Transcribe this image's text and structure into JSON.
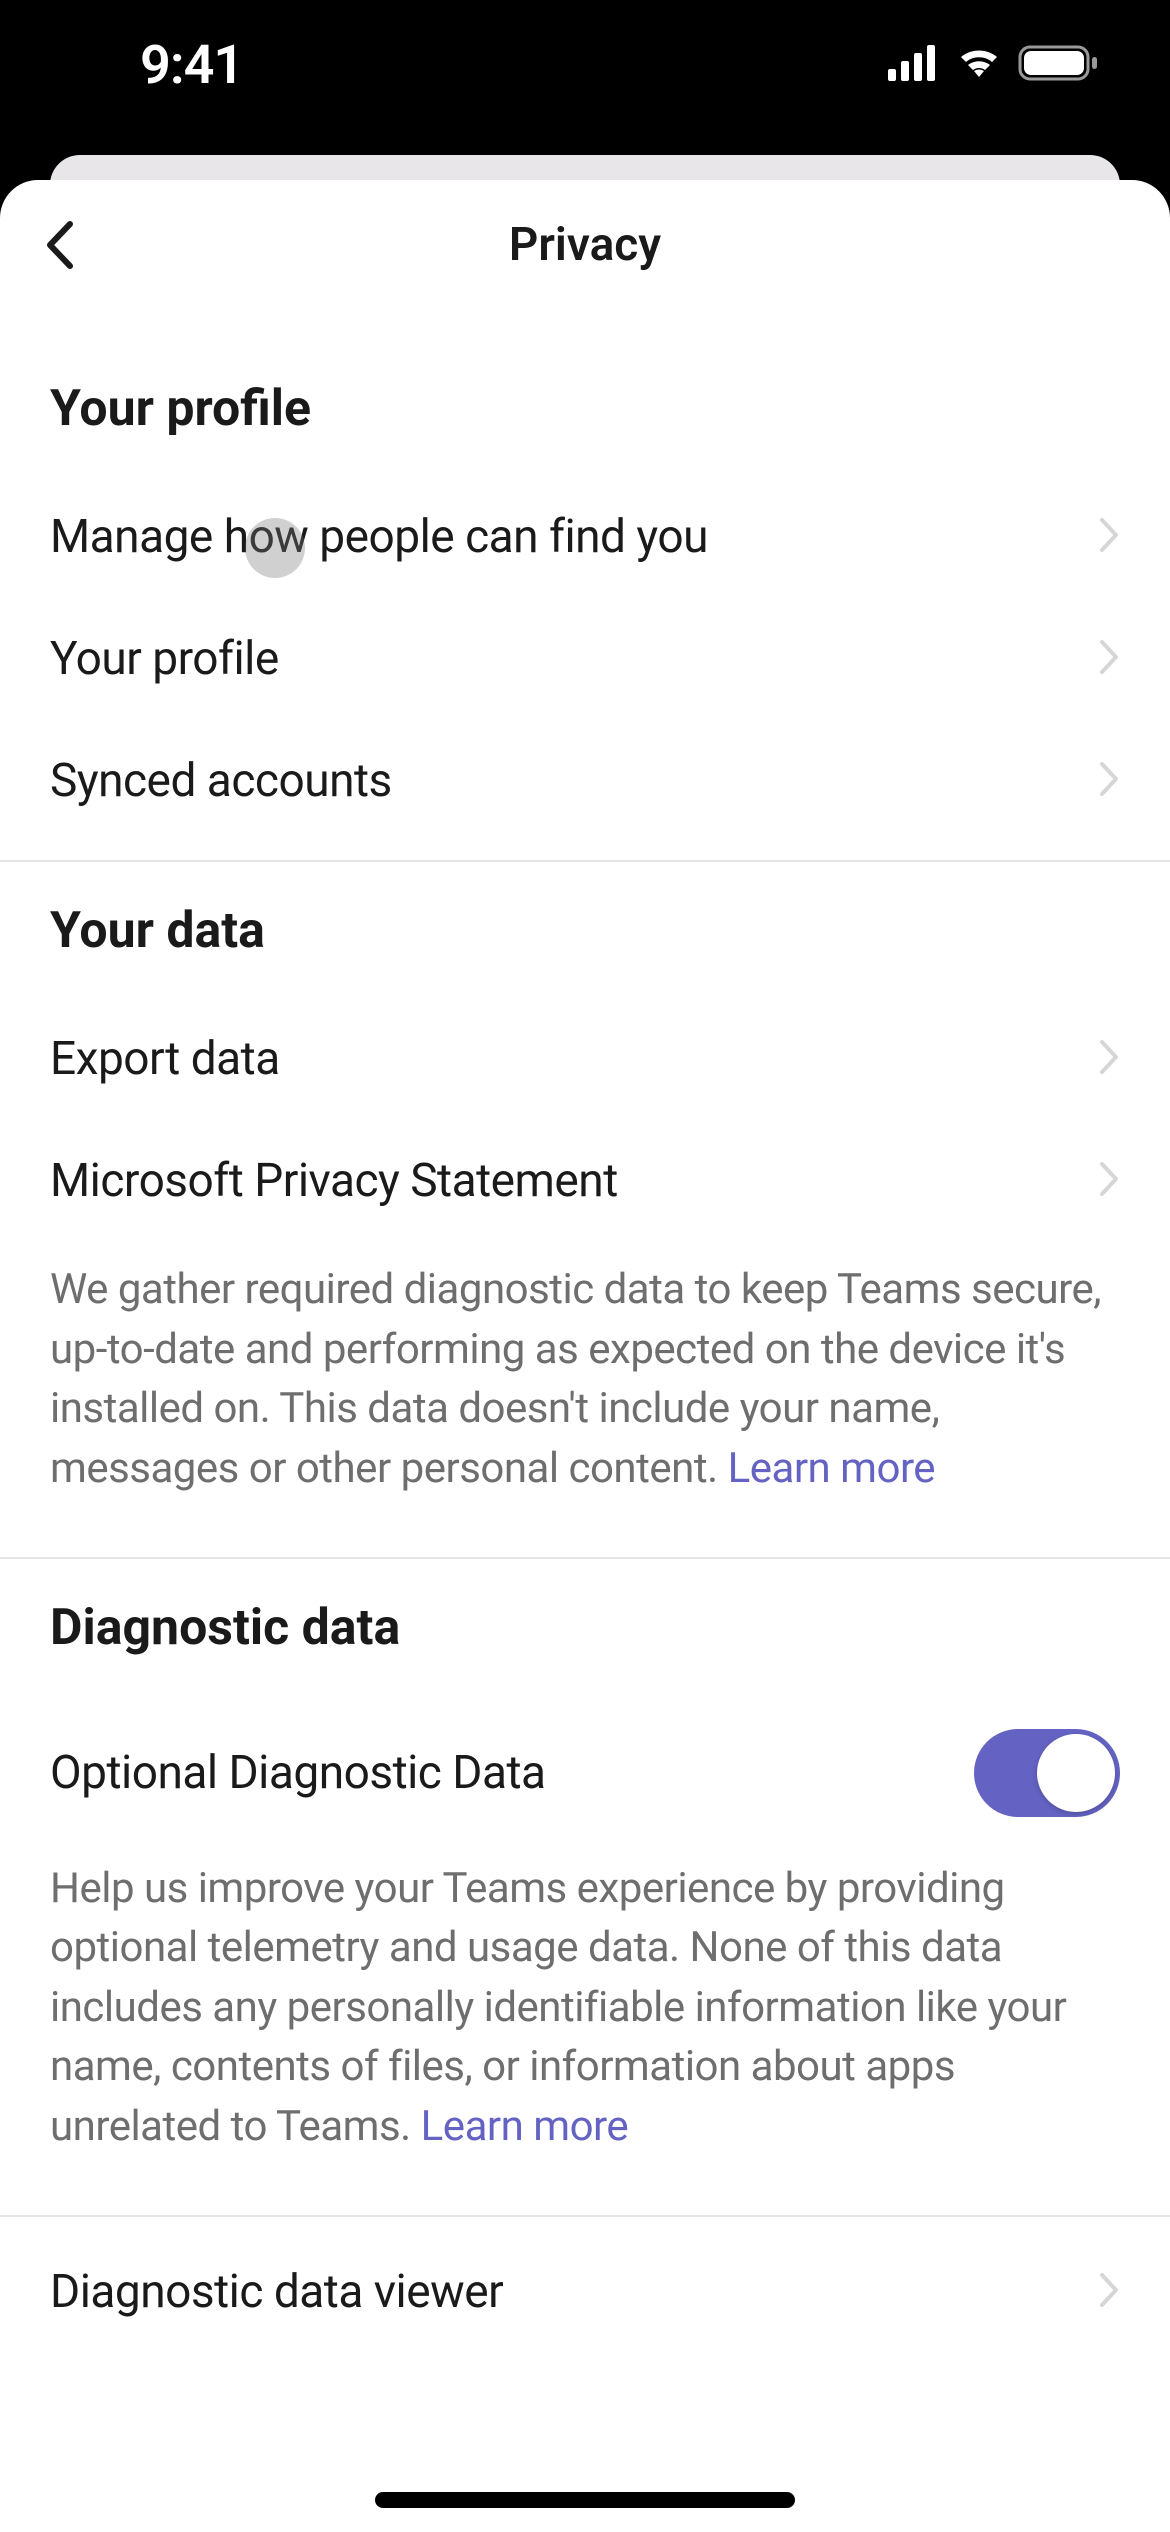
{
  "status_bar": {
    "time": "9:41"
  },
  "header": {
    "title": "Privacy"
  },
  "sections": {
    "profile": {
      "header": "Your profile",
      "items": {
        "manage_find": "Manage how people can find you",
        "your_profile": "Your profile",
        "synced_accounts": "Synced accounts"
      }
    },
    "data": {
      "header": "Your data",
      "items": {
        "export_data": "Export data",
        "privacy_statement": "Microsoft Privacy Statement"
      },
      "description": "We gather required diagnostic data to keep Teams secure, up-to-date and performing as expected on the device it's installed on. This data doesn't include your name, messages or other personal content. ",
      "learn_more": "Learn more"
    },
    "diagnostic": {
      "header": "Diagnostic data",
      "toggle_label": "Optional Diagnostic Data",
      "toggle_on": true,
      "description": "Help us improve your Teams experience by providing optional telemetry and usage data. None of this data includes any personally identifiable information like your name, contents of files, or information about apps unrelated to Teams. ",
      "learn_more": "Learn more",
      "viewer": "Diagnostic data viewer"
    }
  },
  "colors": {
    "accent": "#6463c3"
  }
}
